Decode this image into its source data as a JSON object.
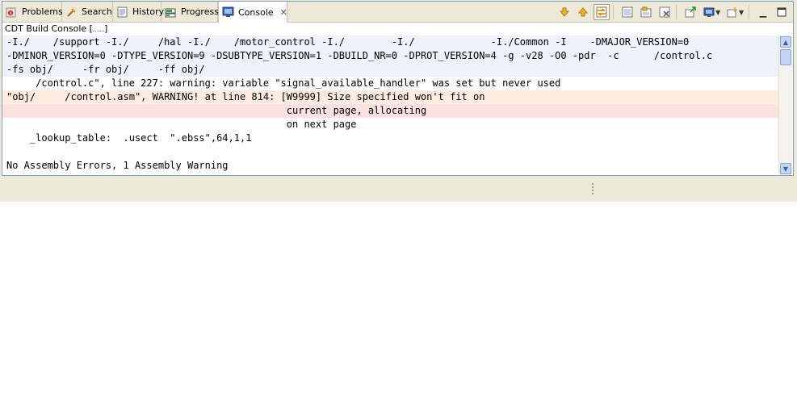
{
  "tabs": [
    {
      "label": "Problems",
      "icon": "problems-icon"
    },
    {
      "label": "Search",
      "icon": "search-icon"
    },
    {
      "label": "History",
      "icon": "history-icon"
    },
    {
      "label": "Progress",
      "icon": "progress-icon"
    },
    {
      "label": "Console",
      "icon": "console-icon",
      "active": true
    }
  ],
  "console_name": "CDT Build Console [",
  "console_name_suffix": "]",
  "output_lines": [
    "-I./    /support -I./     /hal -I./    /motor_control -I./        -I./             -I./Common -I    -DMAJOR_VERSION=0",
    "-DMINOR_VERSION=0 -DTYPE_VERSION=9 -DSUBTYPE_VERSION=1 -DBUILD_NR=0 -DPROT_VERSION=4 -g -v28 -O0 -pdr  -c      /control.c",
    "-fs obj/     -fr obj/     -ff obj/",
    "     /control.c\", line 227: warning: variable \"signal_available_handler\" was set but never used",
    "\"obj/     /control.asm\", WARNING! at line 814: [W9999] Size specified won't fit on",
    "                                                current page, allocating",
    "                                                on next page",
    "    _lookup_table:  .usect  \".ebss\",64,1,1",
    "",
    "No Assembly Errors, 1 Assembly Warning"
  ],
  "toolbar_icons": [
    "scroll-down-icon",
    "scroll-up-icon",
    "scroll-lock-icon",
    "clear-console-icon",
    "pin-console-icon",
    "remove-launch-icon",
    "open-console-icon",
    "display-console-icon",
    "new-console-icon"
  ],
  "colors": {
    "cmd_bg": "#eef2fb",
    "warn_bg": "#fdecdf",
    "warn2_bg": "#fbe1e0"
  }
}
